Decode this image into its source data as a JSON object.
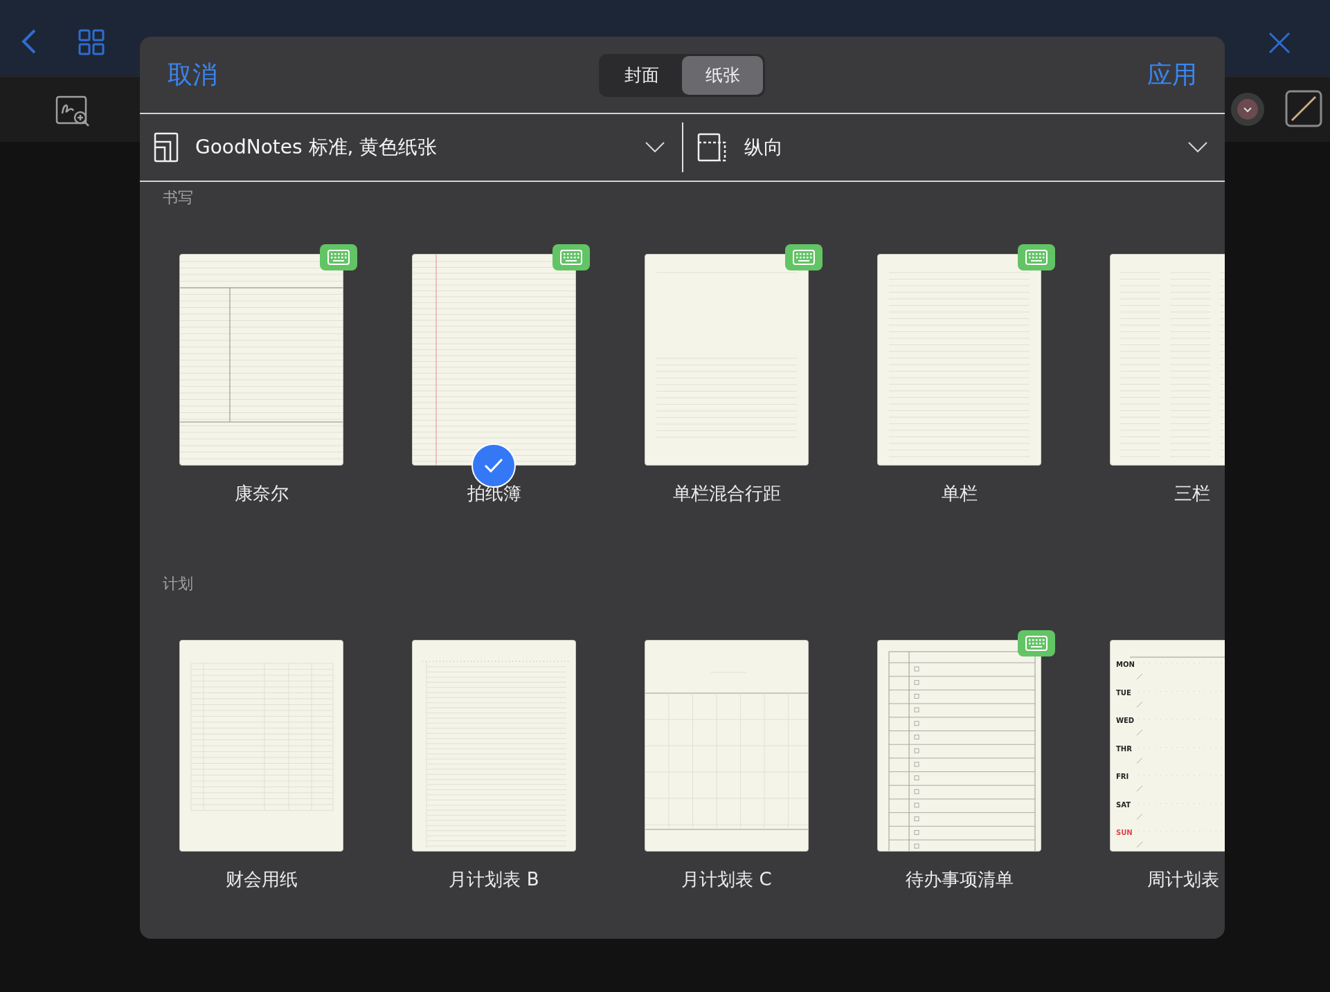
{
  "dialog": {
    "cancel": "取消",
    "apply": "应用",
    "segments": [
      {
        "label": "封面",
        "selected": false
      },
      {
        "label": "纸张",
        "selected": true
      }
    ]
  },
  "pickers": [
    {
      "kind": "template",
      "value": "GoodNotes 标准, 黄色纸张"
    },
    {
      "kind": "orientation",
      "value": "纵向"
    }
  ],
  "sections": [
    {
      "title": "书写",
      "templates": [
        {
          "name": "康奈尔",
          "keyboard": true,
          "selected": false
        },
        {
          "name": "拍纸簿",
          "keyboard": true,
          "selected": true
        },
        {
          "name": "单栏混合行距",
          "keyboard": true,
          "selected": false
        },
        {
          "name": "单栏",
          "keyboard": true,
          "selected": false
        },
        {
          "name": "三栏",
          "keyboard": false,
          "selected": false
        }
      ]
    },
    {
      "title": "计划",
      "templates": [
        {
          "name": "财会用纸",
          "keyboard": false,
          "selected": false
        },
        {
          "name": "月计划表 B",
          "keyboard": false,
          "selected": false
        },
        {
          "name": "月计划表 C",
          "keyboard": false,
          "selected": false
        },
        {
          "name": "待办事项清单",
          "keyboard": true,
          "selected": false
        },
        {
          "name": "周计划表",
          "keyboard": false,
          "selected": false,
          "day_labels": [
            {
              "text": "MON",
              "color": "#222222"
            },
            {
              "text": "TUE",
              "color": "#222222"
            },
            {
              "text": "WED",
              "color": "#222222"
            },
            {
              "text": "THR",
              "color": "#222222"
            },
            {
              "text": "FRI",
              "color": "#222222"
            },
            {
              "text": "SAT",
              "color": "#222222"
            },
            {
              "text": "SUN",
              "color": "#e0454a"
            }
          ]
        }
      ]
    }
  ]
}
